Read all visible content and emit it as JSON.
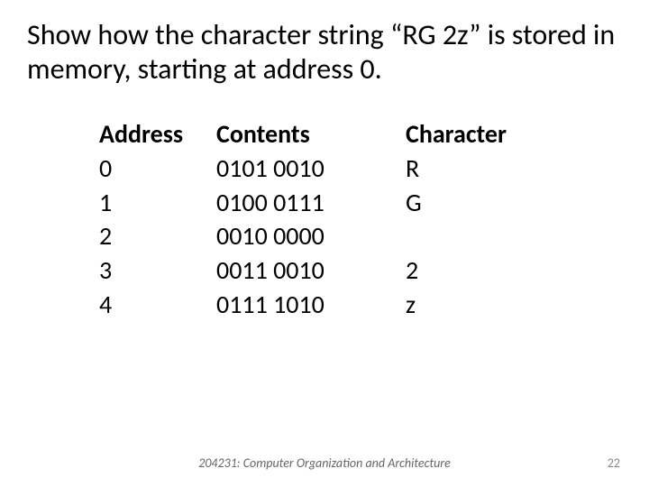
{
  "title": "Show how the character string “RG 2z” is stored in memory, starting at address 0.",
  "headers": {
    "address": "Address",
    "contents": "Contents",
    "character": "Character"
  },
  "rows": [
    {
      "address": "0",
      "contents": "0101 0010",
      "character": "R"
    },
    {
      "address": "1",
      "contents": "0100 0111",
      "character": "G"
    },
    {
      "address": "2",
      "contents": "0010 0000",
      "character": ""
    },
    {
      "address": "3",
      "contents": "0011 0010",
      "character": "2"
    },
    {
      "address": "4",
      "contents": "0111 1010",
      "character": "z"
    }
  ],
  "footer": "204231: Computer Organization and Architecture",
  "page_number": "22"
}
